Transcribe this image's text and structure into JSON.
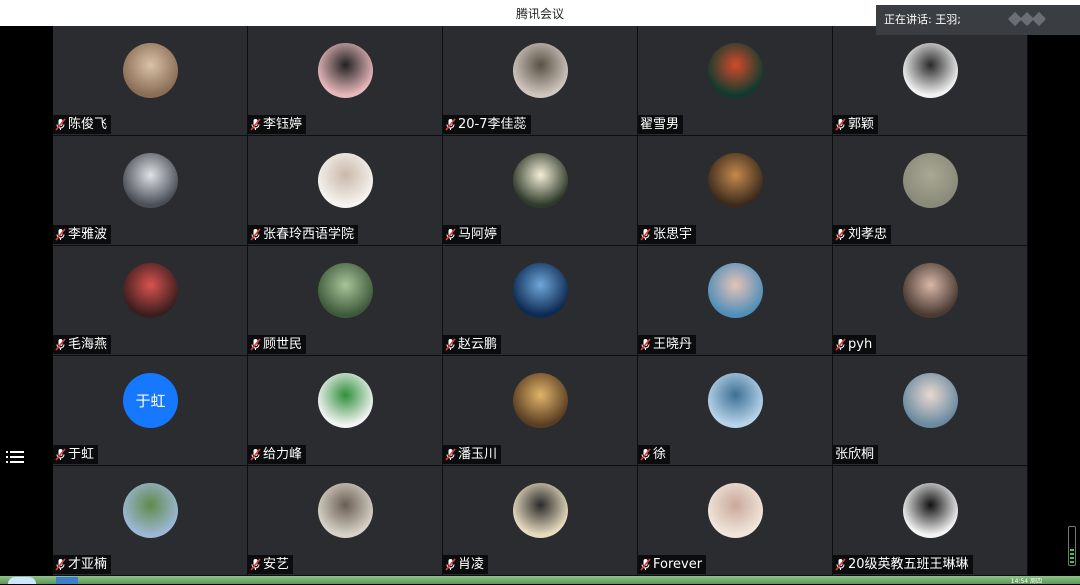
{
  "app": {
    "title": "腾讯会议"
  },
  "speaking": {
    "text": "正在讲话: 王羽;"
  },
  "participants": [
    {
      "name": "陈俊飞",
      "muted": true,
      "avatar_color": "#8a6d55",
      "avatar_color2": "#d9c2a8"
    },
    {
      "name": "李钰婷",
      "muted": true,
      "avatar_color": "#e7b8bc",
      "avatar_color2": "#222222"
    },
    {
      "name": "20-7李佳蕊",
      "muted": true,
      "avatar_color": "#cfc7bf",
      "avatar_color2": "#5a5045"
    },
    {
      "name": "翟雪男",
      "muted": false,
      "avatar_color": "#0f3b2e",
      "avatar_color2": "#d34a2a"
    },
    {
      "name": "郭颖",
      "muted": true,
      "avatar_color": "#f2f2f2",
      "avatar_color2": "#2a2a2a"
    },
    {
      "name": "李雅波",
      "muted": true,
      "avatar_color": "#4a4f57",
      "avatar_color2": "#dfe2e6"
    },
    {
      "name": "张春玲西语学院",
      "muted": true,
      "avatar_color": "#f6f3f0",
      "avatar_color2": "#c9b8a8"
    },
    {
      "name": "马阿婷",
      "muted": true,
      "avatar_color": "#2f3a2a",
      "avatar_color2": "#f3efd8"
    },
    {
      "name": "张思宇",
      "muted": true,
      "avatar_color": "#3a2a1e",
      "avatar_color2": "#c58a4a"
    },
    {
      "name": "刘孝忠",
      "muted": true,
      "avatar_color": "#8a8a7a",
      "avatar_color2": "#a9a894"
    },
    {
      "name": "毛海燕",
      "muted": true,
      "avatar_color": "#3a1e1e",
      "avatar_color2": "#d9534f"
    },
    {
      "name": "顾世民",
      "muted": true,
      "avatar_color": "#3e5a3a",
      "avatar_color2": "#a7c49a"
    },
    {
      "name": "赵云鹏",
      "muted": true,
      "avatar_color": "#0d2a52",
      "avatar_color2": "#6fa7d9"
    },
    {
      "name": "王晓丹",
      "muted": true,
      "avatar_color": "#4f8fb8",
      "avatar_color2": "#e6c2b8"
    },
    {
      "name": "pyh",
      "muted": true,
      "avatar_color": "#4a3a32",
      "avatar_color2": "#d8b8a8"
    },
    {
      "name": "于虹",
      "muted": true,
      "avatar_text": "于虹",
      "avatar_color": "#1677ff",
      "avatar_color2": "#1677ff"
    },
    {
      "name": "给力峰",
      "muted": true,
      "avatar_color": "#f4f4f4",
      "avatar_color2": "#2f8f3a"
    },
    {
      "name": "潘玉川",
      "muted": true,
      "avatar_color": "#5a3e22",
      "avatar_color2": "#e0b46a"
    },
    {
      "name": "徐",
      "muted": true,
      "avatar_color": "#b8d4ea",
      "avatar_color2": "#3d6f94"
    },
    {
      "name": "张欣桐",
      "muted": false,
      "avatar_color": "#6a8aa0",
      "avatar_color2": "#e9d9d0"
    },
    {
      "name": "才亚楠",
      "muted": true,
      "avatar_color": "#9cb8d6",
      "avatar_color2": "#5f8a4a"
    },
    {
      "name": "安艺",
      "muted": true,
      "avatar_color": "#d8d2c8",
      "avatar_color2": "#6a5e52"
    },
    {
      "name": "肖凌",
      "muted": true,
      "avatar_color": "#e8dcc0",
      "avatar_color2": "#2a2a2a"
    },
    {
      "name": "Forever",
      "muted": true,
      "avatar_color": "#f2e6dc",
      "avatar_color2": "#c9a89a"
    },
    {
      "name": "20级英教五班王琳琳",
      "muted": true,
      "avatar_color": "#f4f4f4",
      "avatar_color2": "#111111"
    }
  ],
  "taskbar": {
    "clock": "14:54 周四"
  }
}
